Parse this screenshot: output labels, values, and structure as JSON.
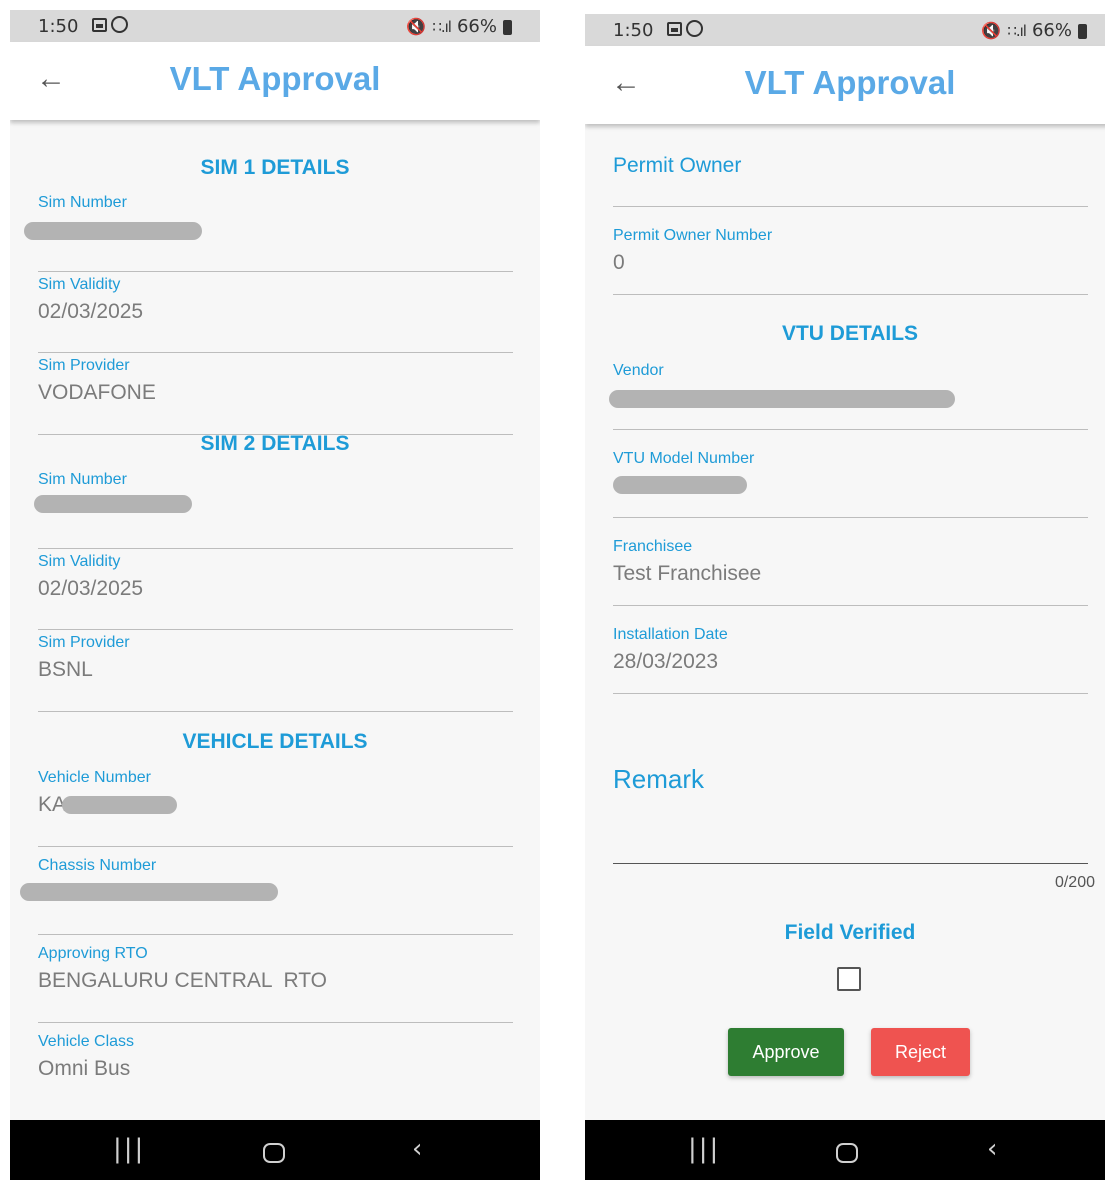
{
  "status_bar": {
    "time": "1:50",
    "battery": "66%"
  },
  "app_bar": {
    "title": "VLT Approval"
  },
  "left_screen": {
    "sim1": {
      "heading": "SIM 1 DETAILS",
      "sim_number_label": "Sim Number",
      "sim_validity_label": "Sim Validity",
      "sim_validity_value": "02/03/2025",
      "sim_provider_label": "Sim Provider",
      "sim_provider_value": "VODAFONE"
    },
    "sim2": {
      "heading": "SIM 2 DETAILS",
      "sim_number_label": "Sim Number",
      "sim_validity_label": "Sim Validity",
      "sim_validity_value": "02/03/2025",
      "sim_provider_label": "Sim Provider",
      "sim_provider_value": "BSNL"
    },
    "vehicle": {
      "heading": "VEHICLE DETAILS",
      "vehicle_number_label": "Vehicle Number",
      "vehicle_number_prefix": "KA",
      "chassis_number_label": "Chassis Number",
      "approving_rto_label": "Approving RTO",
      "approving_rto_value": "BENGALURU CENTRAL  RTO",
      "vehicle_class_label": "Vehicle Class",
      "vehicle_class_value": "Omni Bus"
    }
  },
  "right_screen": {
    "permit_owner_label": "Permit Owner",
    "permit_owner_number_label": "Permit Owner Number",
    "permit_owner_number_value": "0",
    "vtu": {
      "heading": "VTU DETAILS",
      "vendor_label": "Vendor",
      "vtu_model_number_label": "VTU Model Number",
      "franchisee_label": "Franchisee",
      "franchisee_value": "Test Franchisee",
      "installation_date_label": "Installation Date",
      "installation_date_value": "28/03/2023"
    },
    "remark": {
      "label": "Remark",
      "counter": "0/200"
    },
    "field_verified": {
      "label": "Field Verified",
      "checked": false
    },
    "approve_label": "Approve",
    "reject_label": "Reject"
  },
  "colors": {
    "title": "#5aa9e6",
    "accent": "#1e9bd7",
    "approve": "#2e7d32",
    "reject": "#ef5350"
  },
  "icons": {
    "back": "back-arrow-icon",
    "gallery": "gallery-icon",
    "whatsapp": "whatsapp-icon",
    "mute": "mute-icon",
    "wifi": "wifi-icon",
    "signal": "signal-icon",
    "battery": "battery-icon",
    "recents": "recents-icon",
    "home": "home-icon",
    "nav_back": "back-nav-icon"
  }
}
